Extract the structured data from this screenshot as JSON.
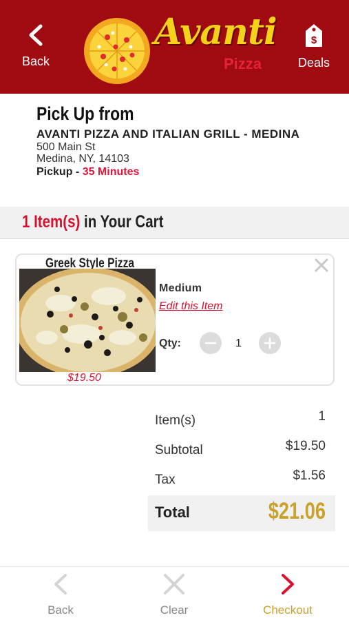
{
  "header": {
    "back_label": "Back",
    "deals_label": "Deals",
    "logo_text": "Avanti",
    "logo_sub": "Pizza",
    "brand_color": "#a00b12"
  },
  "pickup": {
    "title": "Pick Up from",
    "store_name": "AVANTI PIZZA AND ITALIAN GRILL - MEDINA",
    "address_line1": "500 Main St",
    "address_line2": "Medina, NY, 14103",
    "time_label": "Pickup - ",
    "time_value": "35 Minutes"
  },
  "cart": {
    "count_text": "1 Item(s)",
    "suffix_text": " in Your Cart",
    "items": [
      {
        "name": "Greek Style Pizza",
        "size": "Medium",
        "edit_label": "Edit this Item",
        "qty_label": "Qty:",
        "qty": "1",
        "price": "$19.50"
      }
    ]
  },
  "totals": {
    "items_label": "Item(s)",
    "items_value": "1",
    "subtotal_label": "Subtotal",
    "subtotal_value": "$19.50",
    "tax_label": "Tax",
    "tax_value": "$1.56",
    "total_label": "Total",
    "total_value": "$21.06"
  },
  "footer": {
    "back_label": "Back",
    "clear_label": "Clear",
    "checkout_label": "Checkout",
    "checkout_color": "#c9a227",
    "accent_red": "#d9112f"
  },
  "icons": {
    "back": "chevron-left-icon",
    "deals": "price-tag-icon",
    "close": "close-icon",
    "minus": "minus-icon",
    "plus": "plus-icon",
    "clear": "x-icon",
    "checkout": "chevron-right-icon"
  }
}
